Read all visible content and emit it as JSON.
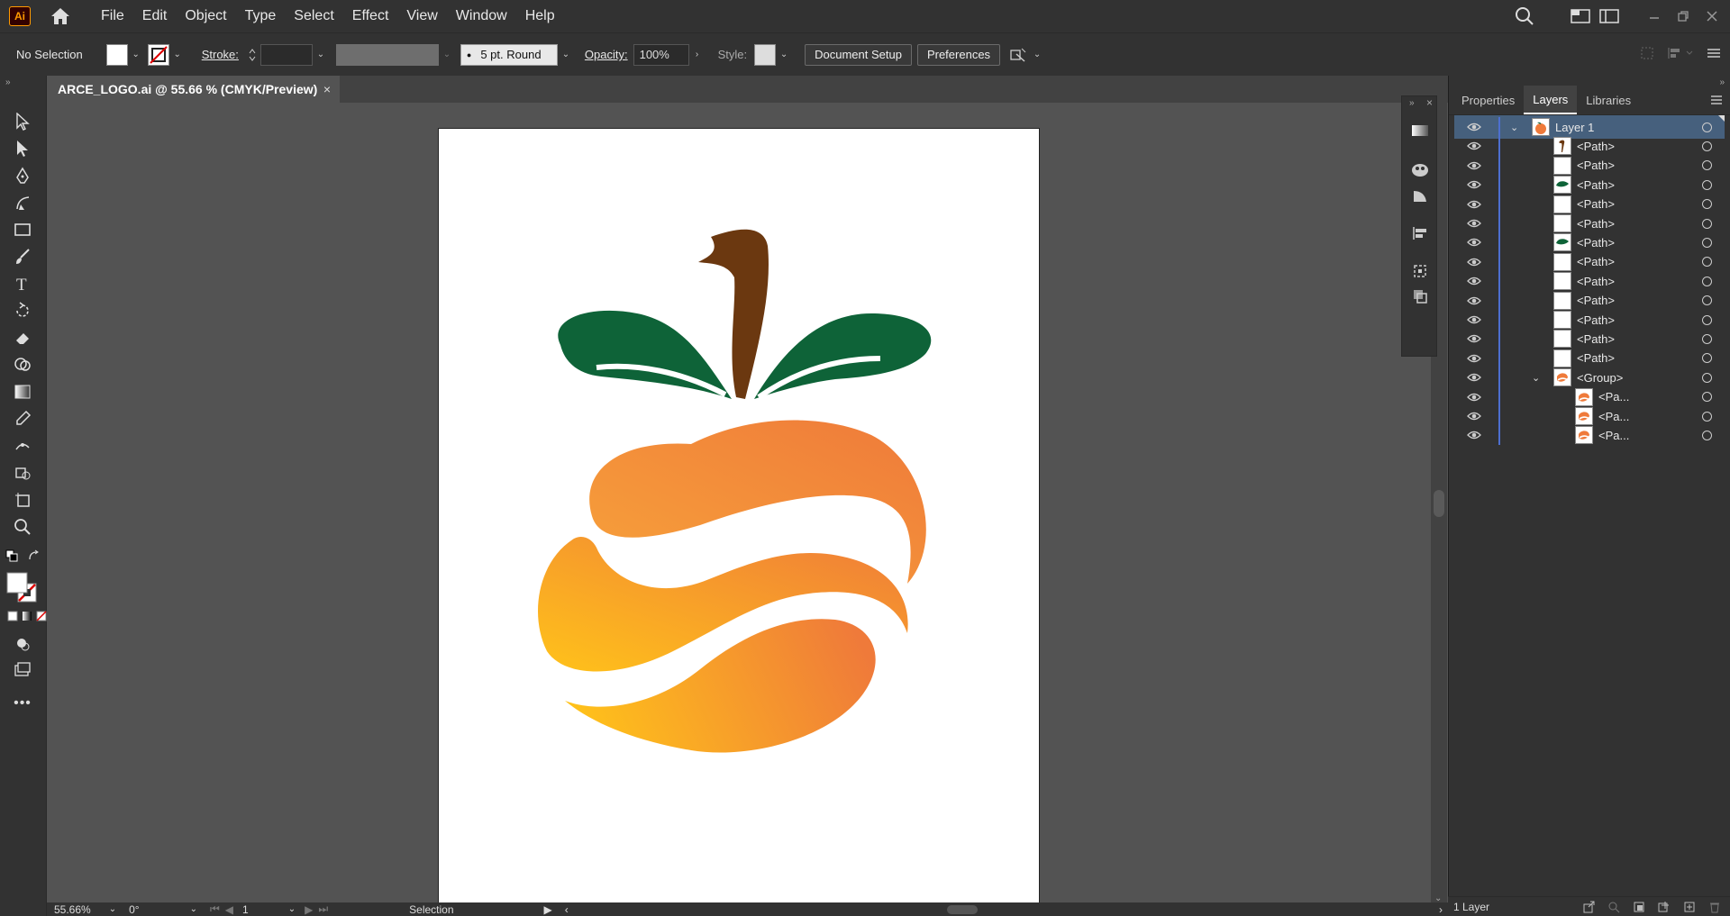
{
  "menubar": {
    "app_badge": "Ai",
    "items": [
      "File",
      "Edit",
      "Object",
      "Type",
      "Select",
      "Effect",
      "View",
      "Window",
      "Help"
    ]
  },
  "controlbar": {
    "selection_label": "No Selection",
    "stroke_label": "Stroke:",
    "brush_label": "5 pt. Round",
    "opacity_label": "Opacity:",
    "opacity_value": "100%",
    "style_label": "Style:",
    "document_setup": "Document Setup",
    "preferences": "Preferences"
  },
  "document": {
    "tab_title": "ARCE_LOGO.ai @ 55.66 % (CMYK/Preview)",
    "close": "×"
  },
  "colors": {
    "leaf": "#0e6338",
    "stem": "#6b3810",
    "orange_light": "#ffc21a",
    "orange_dark": "#ef7a3a"
  },
  "layers_panel": {
    "tabs": [
      "Properties",
      "Layers",
      "Libraries"
    ],
    "active_tab": "Layers",
    "rows": [
      {
        "name": "Layer 1",
        "thumb": "logo"
      },
      {
        "name": "<Path>",
        "thumb": "stem"
      },
      {
        "name": "<Path>",
        "thumb": "blank"
      },
      {
        "name": "<Path>",
        "thumb": "leaf"
      },
      {
        "name": "<Path>",
        "thumb": "blank"
      },
      {
        "name": "<Path>",
        "thumb": "blank"
      },
      {
        "name": "<Path>",
        "thumb": "leaf"
      },
      {
        "name": "<Path>",
        "thumb": "blank"
      },
      {
        "name": "<Path>",
        "thumb": "blank"
      },
      {
        "name": "<Path>",
        "thumb": "blank"
      },
      {
        "name": "<Path>",
        "thumb": "blank"
      },
      {
        "name": "<Path>",
        "thumb": "blank"
      },
      {
        "name": "<Path>",
        "thumb": "blank"
      },
      {
        "name": "<Group>",
        "thumb": "orange"
      },
      {
        "name": "<Pa...",
        "thumb": "orange"
      },
      {
        "name": "<Pa...",
        "thumb": "orange"
      },
      {
        "name": "<Pa...",
        "thumb": "orange"
      }
    ],
    "footer": "1 Layer"
  },
  "statusbar": {
    "zoom": "55.66%",
    "rotation": "0°",
    "artboard_number": "1",
    "tool_name": "Selection"
  }
}
